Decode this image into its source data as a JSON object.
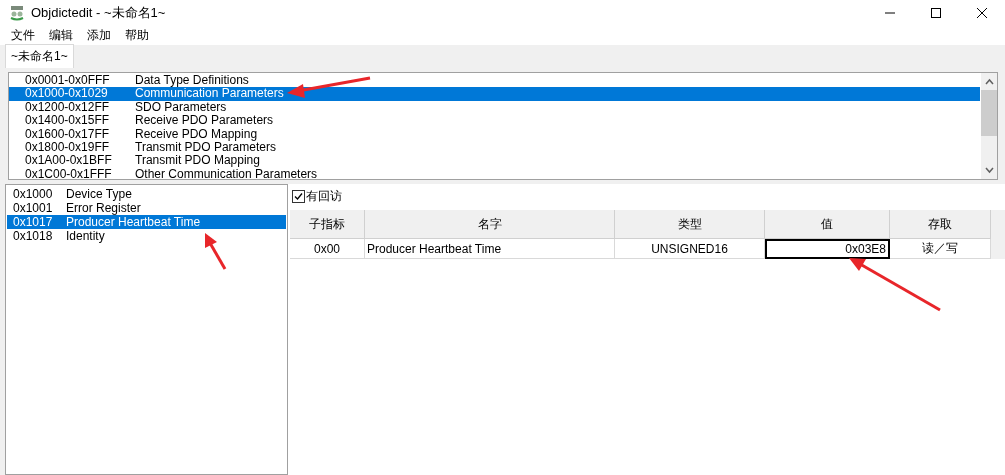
{
  "window": {
    "title": "Objdictedit - ~未命名1~"
  },
  "menu": [
    "文件",
    "编辑",
    "添加",
    "帮助"
  ],
  "tabs": [
    {
      "label": "~未命名1~",
      "selected": true
    }
  ],
  "index_ranges": [
    {
      "range": "0x0001-0x0FFF",
      "name": "Data Type Definitions",
      "selected": false
    },
    {
      "range": "0x1000-0x1029",
      "name": "Communication Parameters",
      "selected": true
    },
    {
      "range": "0x1200-0x12FF",
      "name": "SDO Parameters",
      "selected": false
    },
    {
      "range": "0x1400-0x15FF",
      "name": "Receive PDO Parameters",
      "selected": false
    },
    {
      "range": "0x1600-0x17FF",
      "name": "Receive PDO Mapping",
      "selected": false
    },
    {
      "range": "0x1800-0x19FF",
      "name": "Transmit PDO Parameters",
      "selected": false
    },
    {
      "range": "0x1A00-0x1BFF",
      "name": "Transmit PDO Mapping",
      "selected": false
    },
    {
      "range": "0x1C00-0x1FFF",
      "name": "Other Communication Parameters",
      "selected": false
    }
  ],
  "entries": [
    {
      "index": "0x1000",
      "name": "Device Type",
      "selected": false
    },
    {
      "index": "0x1001",
      "name": "Error Register",
      "selected": false
    },
    {
      "index": "0x1017",
      "name": "Producer Heartbeat Time",
      "selected": true
    },
    {
      "index": "0x1018",
      "name": "Identity",
      "selected": false
    }
  ],
  "callback_option": {
    "label": "有回访",
    "checked": true
  },
  "table": {
    "columns": [
      "子指标",
      "名字",
      "类型",
      "值",
      "存取"
    ],
    "rows": [
      {
        "subindex": "0x00",
        "name": "Producer Heartbeat Time",
        "type": "UNSIGNED16",
        "value": "0x03E8",
        "access": "读／写",
        "value_editing": true
      }
    ]
  }
}
